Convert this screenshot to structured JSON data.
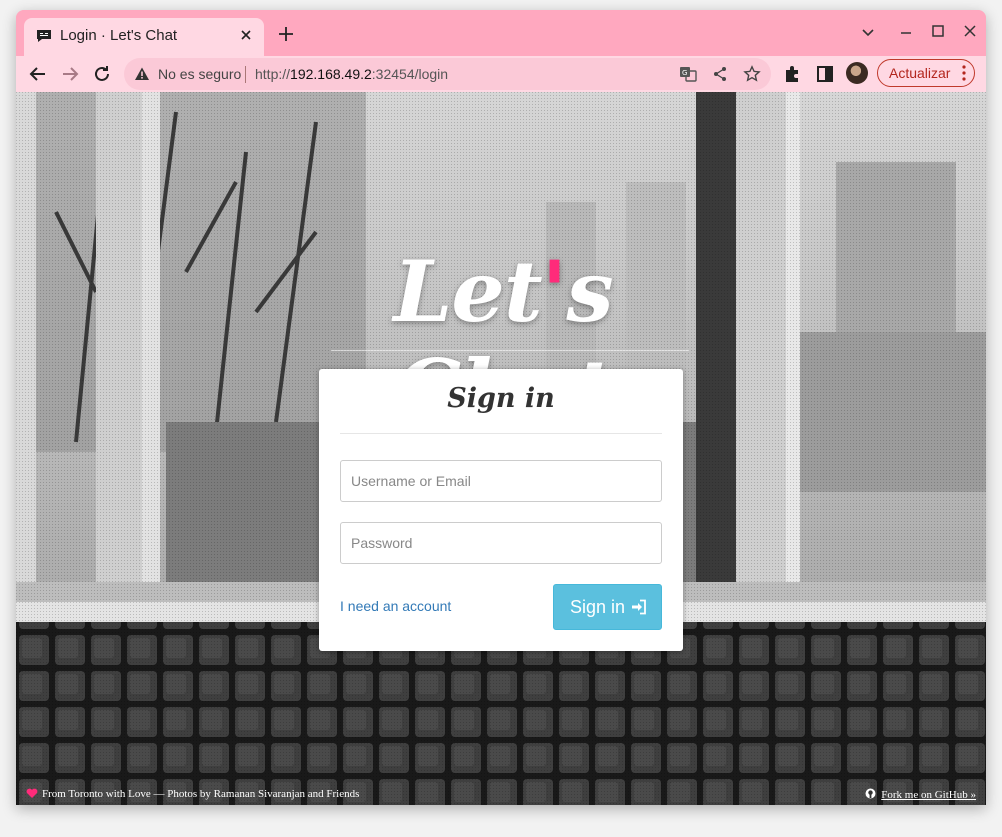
{
  "browser": {
    "tab": {
      "title": "Login · Let's Chat",
      "favicon": "lets-chat-favicon"
    },
    "omnibox": {
      "security_label": "No es seguro",
      "url_scheme": "http://",
      "url_host": "192.168.49.2",
      "url_rest": ":32454/login"
    },
    "update_label": "Actualizar",
    "icons": [
      "back-icon",
      "forward-icon",
      "reload-icon",
      "translate-icon",
      "share-icon",
      "bookmark-star-icon",
      "extensions-icon",
      "side-panel-icon",
      "menu-dots-icon"
    ]
  },
  "page": {
    "logo": {
      "before": "Let",
      "apostrophe": "'",
      "after": "s Chat"
    },
    "signin": {
      "heading": "Sign in",
      "username_placeholder": "Username or Email",
      "password_placeholder": "Password",
      "register_link": "I need an account",
      "submit_label": "Sign in"
    },
    "footer": {
      "credits": "From Toronto with Love — Photos by Ramanan Sivaranjan and Friends",
      "github": "Fork me on GitHub »"
    },
    "colors": {
      "accent": "#ff2b7a",
      "button": "#5bc0de",
      "link": "#337ab7",
      "browser_frame": "#ffb2c6"
    }
  }
}
